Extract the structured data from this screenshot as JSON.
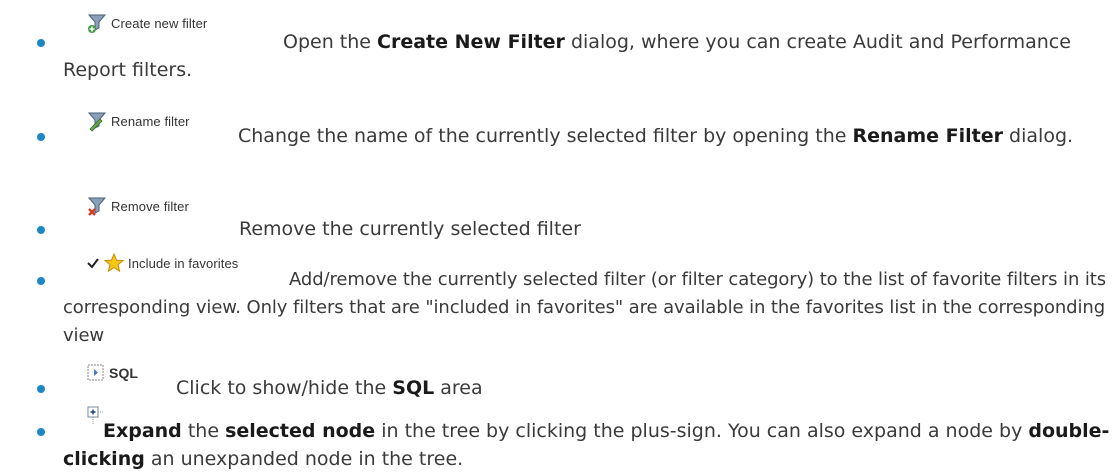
{
  "items": [
    {
      "button": {
        "label": "Create new filter",
        "icon": "funnel-add-icon"
      },
      "text": [
        "Open the ",
        "Create New Filter",
        " dialog, where you can create Audit and Performance Report filters."
      ]
    },
    {
      "button": {
        "label": "Rename filter",
        "icon": "funnel-rename-icon"
      },
      "text": [
        "Change the name of the currently selected filter by opening the ",
        "Rename Filter",
        " dialog."
      ]
    },
    {
      "button": {
        "label": "Remove filter",
        "icon": "funnel-remove-icon"
      },
      "text": [
        "Remove the currently selected filter"
      ]
    },
    {
      "button": {
        "label": "Include in favorites",
        "icon": "star-icon",
        "check_icon": "checkmark-icon"
      },
      "text": [
        "Add/remove the currently selected filter (or filter category) to the list of favorite filters in its corresponding view. Only filters that are \"included in favorites\" are available in the favorites list in the corresponding view"
      ]
    },
    {
      "button": {
        "label": "SQL",
        "icon": "sql-pane-icon"
      },
      "text": [
        "Click to show/hide the ",
        "SQL",
        " area"
      ]
    },
    {
      "button": {
        "label": "",
        "icon": "tree-expand-plus-icon"
      },
      "text": [
        "Expand",
        " the ",
        "selected node",
        " in the tree by clicking the plus-sign. You can also expand a node by ",
        "double-clicking",
        " an unexpanded node in the tree."
      ]
    }
  ],
  "colors": {
    "bullet": "#1e86c4",
    "text": "#3a3a3a",
    "bold": "#1a1a1a"
  }
}
